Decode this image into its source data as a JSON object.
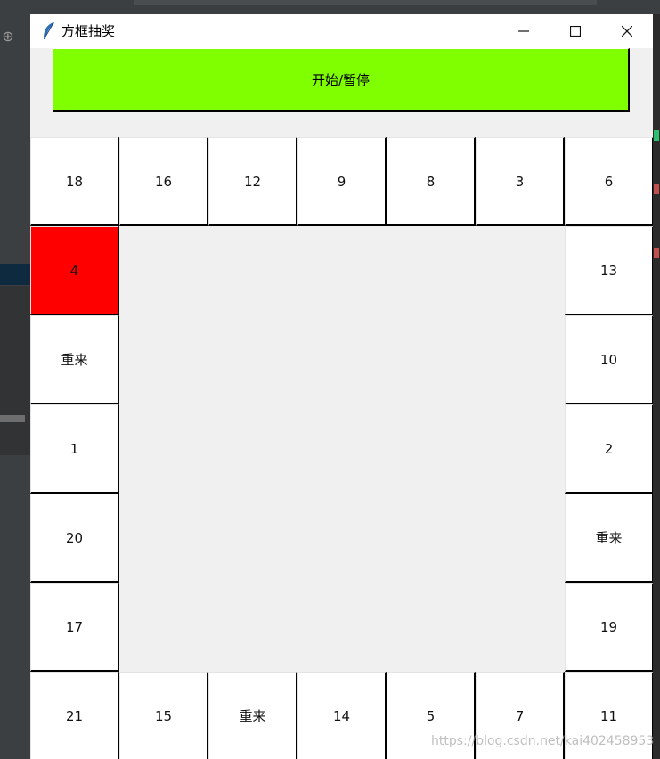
{
  "window": {
    "title": "方框抽奖",
    "icon": "feather-icon"
  },
  "controls": {
    "minimize_icon": "minimize-icon",
    "maximize_icon": "maximize-icon",
    "close_icon": "close-icon"
  },
  "start_button": {
    "label": "开始/暂停",
    "color": "#80ff00"
  },
  "grid": {
    "top_row": [
      "18",
      "16",
      "12",
      "9",
      "8",
      "3",
      "6"
    ],
    "right_column": [
      "13",
      "10",
      "2",
      "重来",
      "19"
    ],
    "bottom_row": [
      "21",
      "15",
      "重来",
      "14",
      "5",
      "7",
      "11"
    ],
    "left_column": [
      "4",
      "重来",
      "1",
      "20",
      "17"
    ],
    "active_cell": "4",
    "active_color": "#ff0000",
    "cell_color": "#ffffff"
  },
  "watermark": "https://blog.csdn.net/kai402458953"
}
